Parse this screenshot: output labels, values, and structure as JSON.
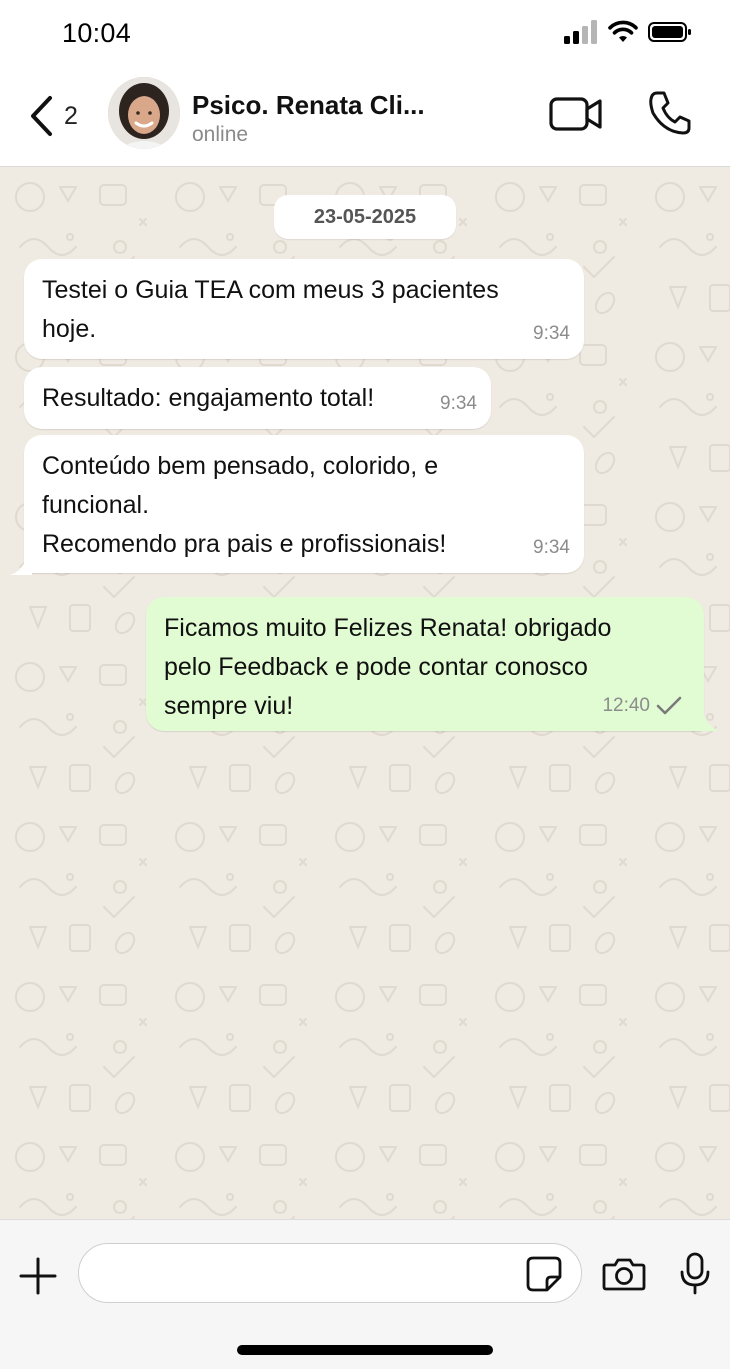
{
  "status_bar": {
    "time": "10:04"
  },
  "header": {
    "back_count": "2",
    "contact_name": "Psico. Renata Cli...",
    "contact_status": "online"
  },
  "chat": {
    "date": "23-05-2025",
    "messages": [
      {
        "direction": "incoming",
        "text": "Testei o Guia TEA com meus 3 pacientes\nhoje.",
        "time": "9:34"
      },
      {
        "direction": "incoming",
        "text": "Resultado: engajamento total!",
        "time": "9:34"
      },
      {
        "direction": "incoming",
        "text": "Conteúdo bem pensado, colorido, e\nfuncional.\nRecomendo pra pais e profissionais!",
        "time": "9:34"
      },
      {
        "direction": "outgoing",
        "text": "Ficamos muito Felizes Renata! obrigado\npelo Feedback e pode contar conosco\nsempre viu!",
        "time": "12:40",
        "status_icon": "single-check-icon"
      }
    ]
  },
  "input_bar": {
    "placeholder": ""
  },
  "icons": {
    "back": "chevron-left-icon",
    "video": "video-camera-icon",
    "call": "phone-icon",
    "plus": "plus-icon",
    "sticker": "sticker-icon",
    "camera": "camera-icon",
    "mic": "microphone-icon"
  },
  "colors": {
    "chat_background": "#efeae2",
    "incoming_bubble": "#ffffff",
    "outgoing_bubble": "#e1fbd3"
  }
}
